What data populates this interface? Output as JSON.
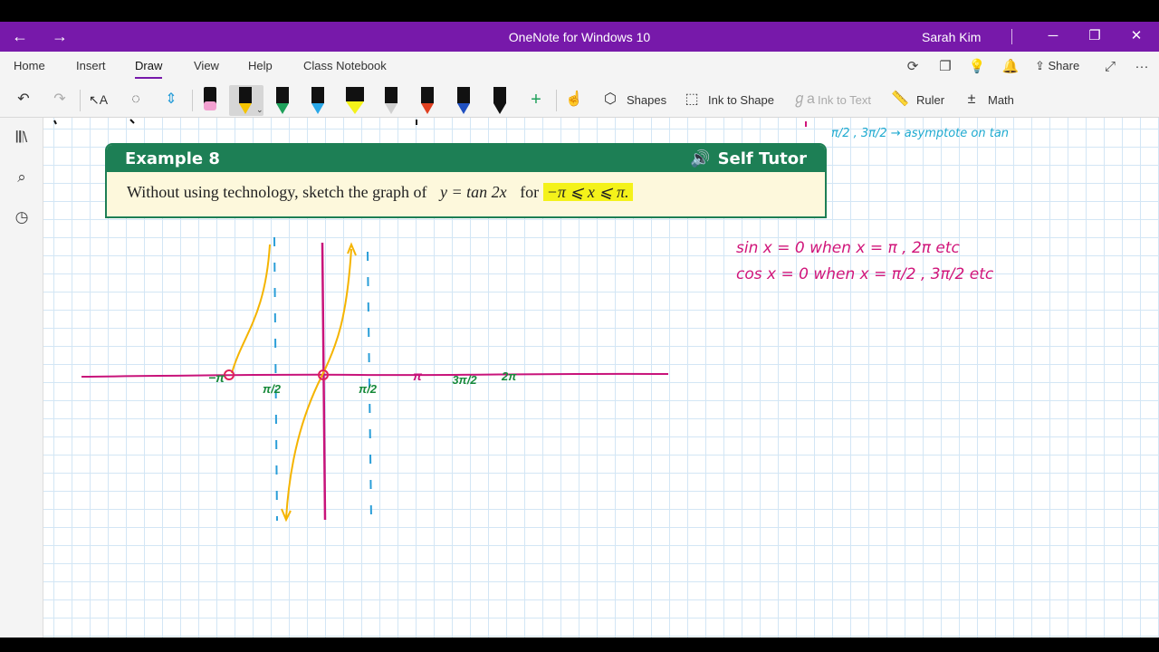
{
  "window": {
    "title": "OneNote for Windows 10",
    "user": "Sarah Kim",
    "back_icon": "arrow-left-icon",
    "forward_icon": "arrow-right-icon",
    "minimize": "─",
    "restore": "❐",
    "close": "✕"
  },
  "menu": {
    "items": [
      "Home",
      "Insert",
      "Draw",
      "View",
      "Help",
      "Class Notebook"
    ],
    "active": "Draw",
    "share_label": "Share",
    "more": "···"
  },
  "toolbar": {
    "shapes_label": "Shapes",
    "ink_to_shape_label": "Ink to Shape",
    "ink_to_text_label": "Ink to Text",
    "ruler_label": "Ruler",
    "math_label": "Math",
    "pen_colors": [
      "#f2a0d0",
      "#f5c400",
      "#1ea05a",
      "#2aa8e8",
      "#f4f21a",
      "#cfcfcf",
      "#e04020",
      "#2050c0",
      "#111111"
    ],
    "accent": "#7719aa"
  },
  "example": {
    "title": "Example 8",
    "badge": "Self Tutor",
    "text_prefix": "Without using technology, sketch the graph of",
    "equation": "y = tan 2x",
    "connector": "for",
    "domain": "−π ⩽ x ⩽ π.",
    "header_color": "#1d7f55",
    "highlight_color": "#f4f21a"
  },
  "notes": {
    "top_right": "π/2 , 3π/2 → asymptote on tan",
    "line1": "sin x = 0  when  x = π , 2π  etc",
    "line2": "cos x = 0  when  x = π/2 , 3π/2  etc",
    "ink_pink": "#d0157a",
    "ink_teal": "#1eaad0"
  },
  "sketch": {
    "tick_labels": [
      "−π",
      "π/2",
      "π/2",
      "π",
      "3π/2",
      "2π"
    ],
    "axis_color": "#c8137a",
    "curve_color": "#f5b400",
    "asymptote_color": "#2a9ed8",
    "label_color": "#178a3a"
  }
}
